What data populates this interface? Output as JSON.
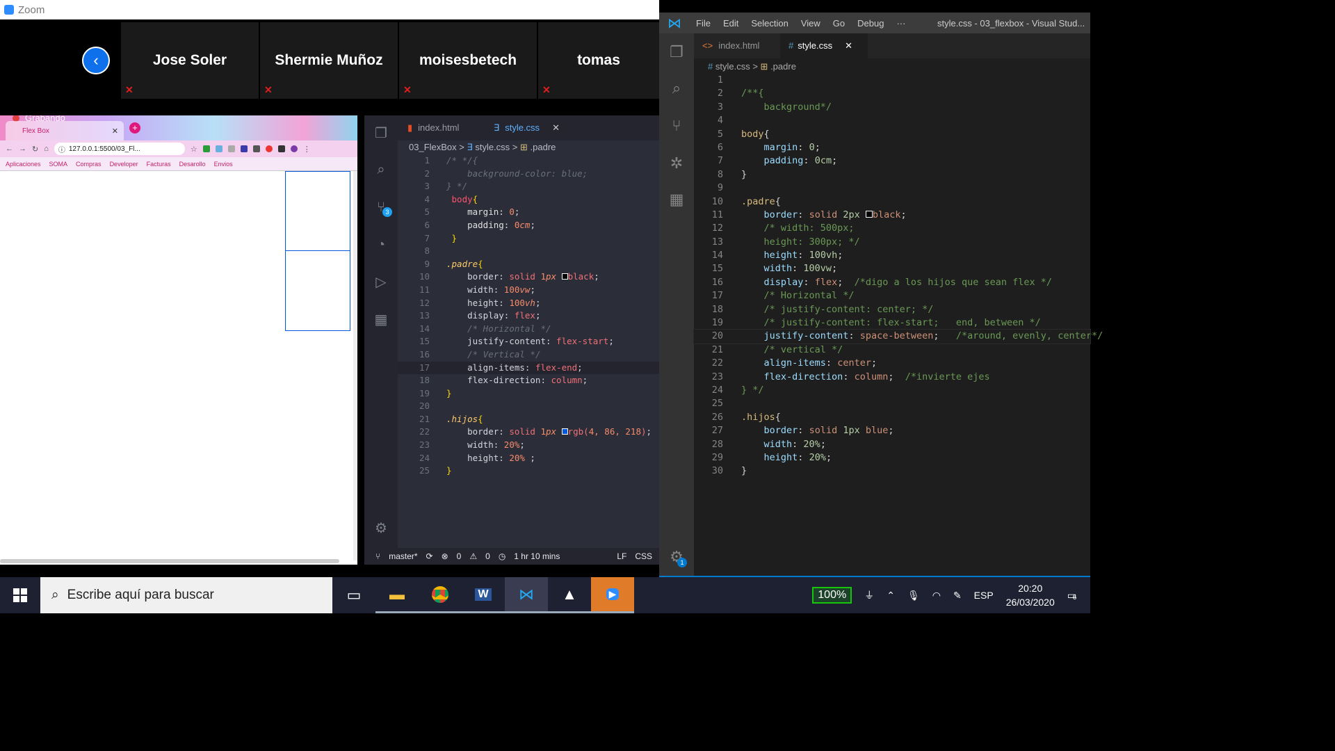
{
  "zoom": {
    "title": "Zoom",
    "participants": [
      {
        "name": "Jose Soler"
      },
      {
        "name": "Shermie Muñoz"
      },
      {
        "name": "moisesbetech"
      },
      {
        "name": "tomas"
      }
    ]
  },
  "chrome": {
    "recording_label": "Grabando",
    "tab_title": "Flex Box",
    "url": "127.0.0.1:5500/03_Fl...",
    "bookmarks": [
      "Aplicaciones",
      "SOMA",
      "Compras",
      "Developer",
      "Facturas",
      "Desarollo",
      "Envios"
    ]
  },
  "mid_editor": {
    "tabs": [
      "index.html",
      "style.css"
    ],
    "breadcrumb": [
      "03_FlexBox",
      "style.css",
      ".padre"
    ],
    "scm_badge": "3",
    "status": {
      "branch": "master*",
      "problems": "0",
      "warnings": "0",
      "time": "1 hr 10 mins",
      "eol": "LF",
      "lang": "CSS"
    }
  },
  "right_editor": {
    "menu": [
      "File",
      "Edit",
      "Selection",
      "View",
      "Go",
      "Debug",
      "···"
    ],
    "window_title": "style.css - 03_flexbox - Visual Stud...",
    "tabs": [
      "index.html",
      "style.css"
    ],
    "breadcrumb": [
      "style.css",
      ".padre"
    ],
    "settings_badge": "1"
  },
  "taskbar": {
    "search_placeholder": "Escribe aquí para buscar",
    "battery": "100%",
    "language": "ESP",
    "time": "20:20",
    "date": "26/03/2020",
    "notification_count": "6"
  }
}
